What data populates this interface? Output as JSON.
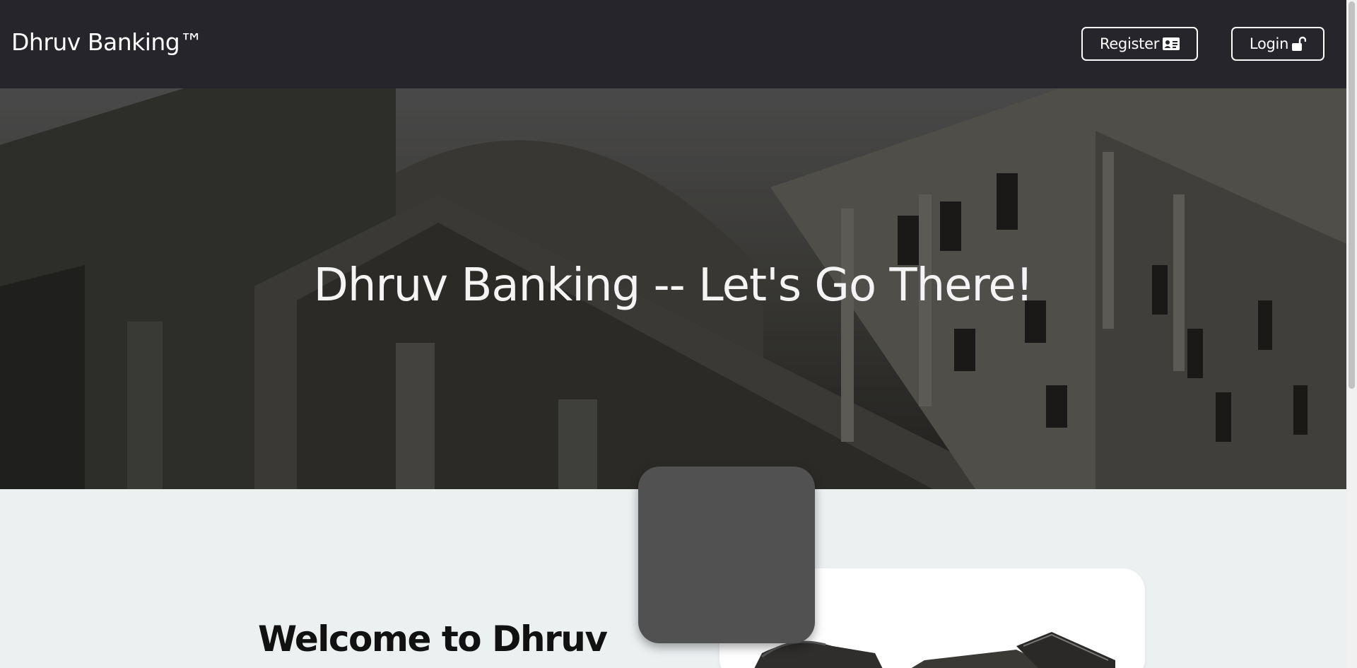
{
  "navbar": {
    "brand": "Dhruv Banking™",
    "register_label": "Register",
    "login_label": "Login"
  },
  "hero": {
    "title": "Dhruv Banking -- Let's Go There!"
  },
  "about": {
    "heading": "Welcome to Dhruv"
  },
  "icons": {
    "register": "id-card-icon",
    "login": "unlock-icon"
  },
  "colors": {
    "navbar_bg": "#25252b",
    "section_bg": "#ecf0f1",
    "card": "#515151"
  }
}
